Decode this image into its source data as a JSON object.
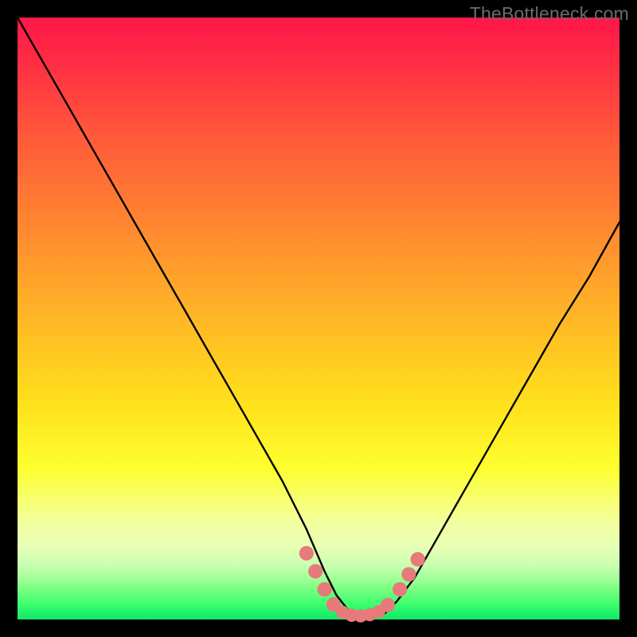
{
  "watermark": "TheBottleneck.com",
  "colors": {
    "frame": "#000000",
    "curve": "#000000",
    "marker_fill": "#e77a7a",
    "marker_stroke": "#d86e6e"
  },
  "chart_data": {
    "type": "line",
    "title": "",
    "xlabel": "",
    "ylabel": "",
    "xlim": [
      0,
      100
    ],
    "ylim": [
      0,
      100
    ],
    "series": [
      {
        "name": "bottleneck-curve",
        "x": [
          0,
          4,
          8,
          12,
          16,
          20,
          24,
          28,
          32,
          36,
          40,
          44,
          48,
          51,
          53,
          55,
          57,
          59,
          61,
          63,
          66,
          70,
          74,
          78,
          82,
          86,
          90,
          95,
          100
        ],
        "y": [
          100,
          93,
          86,
          79,
          72,
          65,
          58,
          51,
          44,
          37,
          30,
          23,
          15,
          8,
          4,
          1.5,
          0.5,
          0.5,
          1,
          3,
          7,
          14,
          21,
          28,
          35,
          42,
          49,
          57,
          66
        ]
      }
    ],
    "markers": [
      {
        "x": 48.0,
        "y": 11.0,
        "r": 1.2
      },
      {
        "x": 49.5,
        "y": 8.0,
        "r": 1.2
      },
      {
        "x": 51.0,
        "y": 5.0,
        "r": 1.2
      },
      {
        "x": 52.5,
        "y": 2.5,
        "r": 1.2
      },
      {
        "x": 54.0,
        "y": 1.2,
        "r": 1.1
      },
      {
        "x": 55.5,
        "y": 0.7,
        "r": 1.1
      },
      {
        "x": 57.0,
        "y": 0.6,
        "r": 1.1
      },
      {
        "x": 58.5,
        "y": 0.8,
        "r": 1.1
      },
      {
        "x": 60.0,
        "y": 1.3,
        "r": 1.1
      },
      {
        "x": 61.5,
        "y": 2.4,
        "r": 1.2
      },
      {
        "x": 63.5,
        "y": 5.0,
        "r": 1.2
      },
      {
        "x": 65.0,
        "y": 7.5,
        "r": 1.2
      },
      {
        "x": 66.5,
        "y": 10.0,
        "r": 1.2
      }
    ]
  }
}
